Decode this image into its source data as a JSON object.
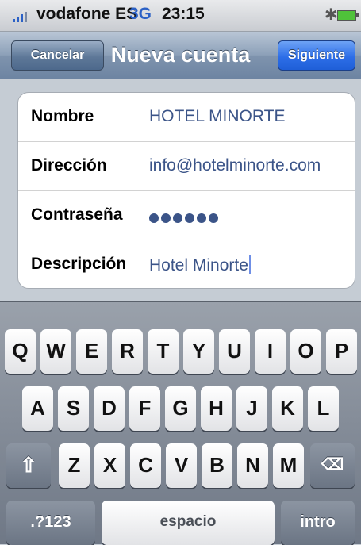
{
  "status_bar": {
    "carrier": "vodafone ES",
    "network": "3G",
    "time": "23:15",
    "bluetooth_icon": "bluetooth-icon",
    "battery_icon": "battery-icon"
  },
  "nav_bar": {
    "title": "Nueva cuenta",
    "cancel_label": "Cancelar",
    "next_label": "Siguiente"
  },
  "form": {
    "fields": [
      {
        "label": "Nombre",
        "value": "HOTEL MINORTE"
      },
      {
        "label": "Dirección",
        "value": "info@hotelminorte.com"
      },
      {
        "label": "Contraseña",
        "value_masked_length": 6
      },
      {
        "label": "Descripción",
        "value": "Hotel Minorte"
      }
    ]
  },
  "keyboard": {
    "row1": [
      "Q",
      "W",
      "E",
      "R",
      "T",
      "Y",
      "U",
      "I",
      "O",
      "P"
    ],
    "row2": [
      "A",
      "S",
      "D",
      "F",
      "G",
      "H",
      "J",
      "K",
      "L"
    ],
    "row3": [
      "Z",
      "X",
      "C",
      "V",
      "B",
      "N",
      "M"
    ],
    "shift_icon": "shift-arrow-icon",
    "backspace_icon": "backspace-icon",
    "numbers_label": ".?123",
    "space_label": "espacio",
    "return_label": "intro"
  },
  "colors": {
    "value_text": "#3b5488",
    "primary_button": "#2d6ee8",
    "nav_bar": "#7f94ae"
  }
}
